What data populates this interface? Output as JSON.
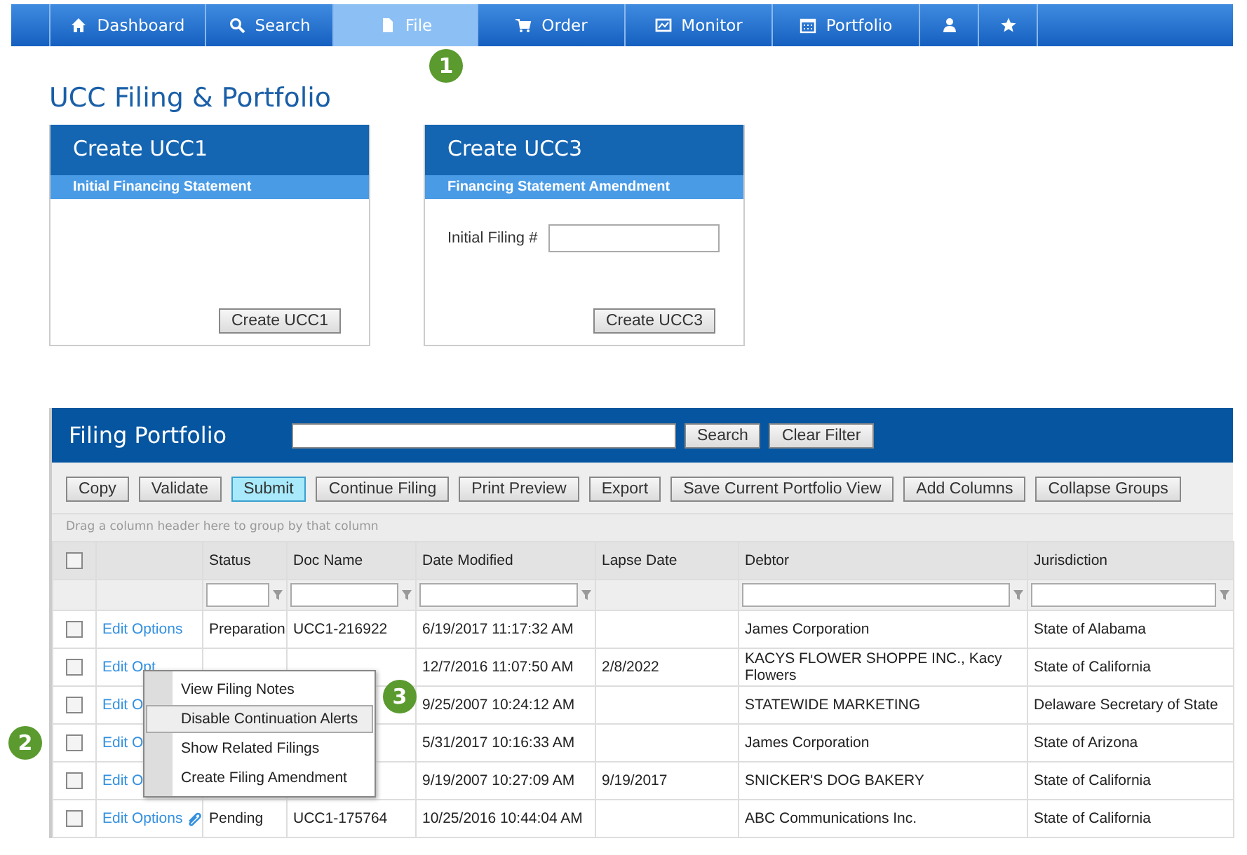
{
  "nav": [
    {
      "label": "Dashboard",
      "selected": false
    },
    {
      "label": "Search",
      "selected": false
    },
    {
      "label": "File",
      "selected": true
    },
    {
      "label": "Order",
      "selected": false
    },
    {
      "label": "Monitor",
      "selected": false
    },
    {
      "label": "Portfolio",
      "selected": false
    },
    {
      "selected": false
    },
    {
      "selected": false
    }
  ],
  "page_title": "UCC Filing & Portfolio",
  "cards": [
    {
      "title": "Create UCC1",
      "subtitle": "Initial Financing Statement",
      "button": "Create UCC1"
    },
    {
      "title": "Create UCC3",
      "subtitle": "Financing Statement Amendment",
      "field_label": "Initial Filing #",
      "button": "Create UCC3"
    }
  ],
  "portfolio": {
    "title": "Filing Portfolio",
    "search_button": "Search",
    "clear_button": "Clear Filter",
    "toolbar": [
      {
        "label": "Copy",
        "selected": false
      },
      {
        "label": "Validate",
        "selected": false
      },
      {
        "label": "Submit",
        "selected": true
      },
      {
        "label": "Continue Filing",
        "selected": false
      },
      {
        "label": "Print Preview",
        "selected": false
      },
      {
        "label": "Export",
        "selected": false
      },
      {
        "label": "Save Current Portfolio View",
        "selected": false
      },
      {
        "label": "Add Columns",
        "selected": false
      },
      {
        "label": "Collapse Groups",
        "selected": false
      }
    ],
    "group_hint": "Drag a column header here to group by that column",
    "header_checked": false,
    "columns": [
      {
        "label": "Status",
        "filter": true
      },
      {
        "label": "Doc Name",
        "filter": true
      },
      {
        "label": "Date Modified",
        "filter": true
      },
      {
        "label": "Lapse Date",
        "filter": false
      },
      {
        "label": "Debtor",
        "filter": true
      },
      {
        "label": "Jurisdiction",
        "filter": true
      }
    ],
    "rows": [
      {
        "checked": false,
        "link": "Edit Options",
        "attachment": false,
        "cells": [
          "Preparation",
          "UCC1-216922",
          "6/19/2017 11:17:32 AM",
          null,
          "James Corporation",
          "State of Alabama"
        ]
      },
      {
        "checked": false,
        "link": "Edit Opt",
        "attachment": false,
        "cells": [
          null,
          null,
          "12/7/2016 11:07:50 AM",
          "2/8/2022",
          "KACYS FLOWER SHOPPE INC., Kacy Flowers",
          "State of California"
        ]
      },
      {
        "checked": false,
        "link": "Edit O",
        "attachment": false,
        "cells": [
          null,
          null,
          "9/25/2007 10:24:12 AM",
          null,
          "STATEWIDE MARKETING",
          "Delaware Secretary of State"
        ]
      },
      {
        "checked": false,
        "link": "Edit O",
        "attachment": false,
        "cells": [
          null,
          null,
          "5/31/2017 10:16:33 AM",
          null,
          "James Corporation",
          "State of Arizona"
        ]
      },
      {
        "checked": false,
        "link": "Edit O",
        "attachment": false,
        "cells": [
          null,
          null,
          "9/19/2007 10:27:09 AM",
          "9/19/2017",
          "SNICKER'S DOG BAKERY",
          "State of California"
        ]
      },
      {
        "checked": false,
        "link": "Edit Options",
        "attachment": true,
        "cells": [
          "Pending",
          "UCC1-175764",
          "10/25/2016 10:44:04 AM",
          null,
          "ABC Communications Inc.",
          "State of California"
        ]
      }
    ]
  },
  "context_menu": [
    {
      "label": "View Filing Notes",
      "selected": false
    },
    {
      "label": "Disable Continuation Alerts",
      "selected": true
    },
    {
      "label": "Show Related Filings",
      "selected": false
    },
    {
      "label": "Create Filing Amendment",
      "selected": false
    }
  ],
  "callouts": [
    "1",
    "2",
    "3"
  ]
}
